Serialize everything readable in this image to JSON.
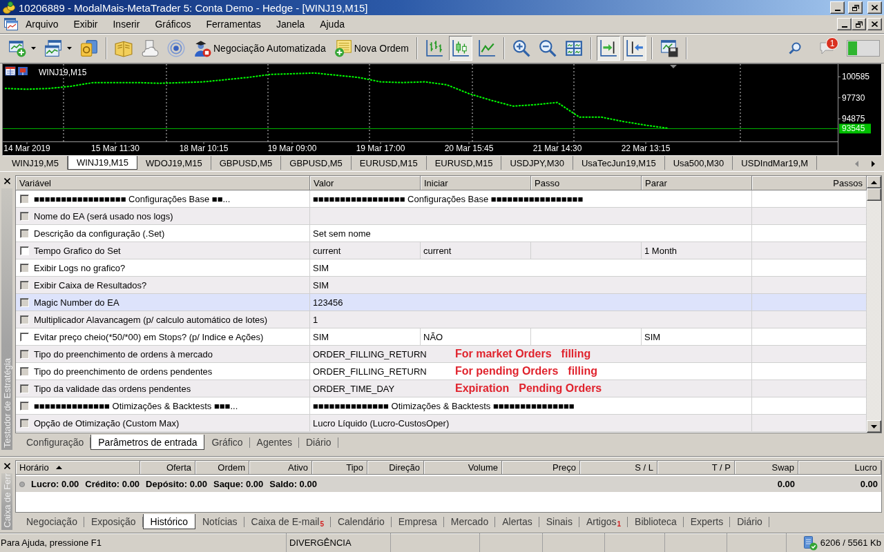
{
  "window": {
    "title": "10206889 - ModalMais-MetaTrader 5: Conta Demo - Hedge - [WINJ19,M15]"
  },
  "menu": [
    "Arquivo",
    "Exibir",
    "Inserir",
    "Gráficos",
    "Ferramentas",
    "Janela",
    "Ajuda"
  ],
  "toolbar": {
    "items": [
      {
        "kind": "button",
        "dropdown": true,
        "pressed": false
      },
      {
        "kind": "button",
        "dropdown": true,
        "pressed": false
      },
      {
        "kind": "button",
        "pressed": false
      },
      {
        "kind": "separator"
      },
      {
        "kind": "button",
        "pressed": false
      },
      {
        "kind": "button",
        "pressed": false
      },
      {
        "kind": "button",
        "pressed": false
      },
      {
        "kind": "button",
        "label": "Negociação Automatizada",
        "pressed": false
      },
      {
        "kind": "button",
        "label": "Nova Ordem",
        "pressed": false
      },
      {
        "kind": "separator"
      },
      {
        "kind": "button",
        "pressed": false
      },
      {
        "kind": "button",
        "pressed": true
      },
      {
        "kind": "button",
        "pressed": false
      },
      {
        "kind": "separator"
      },
      {
        "kind": "button",
        "pressed": false
      },
      {
        "kind": "button",
        "pressed": false
      },
      {
        "kind": "button",
        "pressed": false
      },
      {
        "kind": "separator"
      },
      {
        "kind": "button",
        "pressed": true
      },
      {
        "kind": "button",
        "pressed": true
      },
      {
        "kind": "separator"
      },
      {
        "kind": "button",
        "pressed": false
      },
      {
        "kind": "separator"
      }
    ],
    "notification_count": "1"
  },
  "chart": {
    "chart_data": {
      "type": "line",
      "title": "WINJ19,M15",
      "categories": [
        null,
        "14 Mar 2019",
        null,
        null,
        null,
        "15 Mar 11:30",
        null,
        null,
        null,
        "18 Mar 10:15",
        null,
        null,
        null,
        "19 Mar 09:00",
        null,
        null,
        null,
        "19 Mar 17:00",
        null,
        null,
        null,
        "20 Mar 15:45",
        null,
        null,
        null,
        "21 Mar 14:30",
        null,
        null,
        null,
        "22 Mar 13:15",
        null
      ],
      "series": [
        {
          "color": "#00ff00",
          "line_style": "dashed",
          "values": [
            99000,
            98900,
            99000,
            99300,
            99800,
            99800,
            99800,
            99700,
            99800,
            99900,
            100200,
            100500,
            100900,
            101000,
            101100,
            100800,
            100500,
            99900,
            99800,
            99900,
            99500,
            98300,
            97400,
            96600,
            96800,
            97100,
            95100,
            95100,
            94500,
            94000,
            93600
          ]
        }
      ],
      "ylim": [
        91800,
        102300
      ],
      "yticks": [
        100585,
        97730,
        94875
      ],
      "ref_lines": [
        {
          "axis": "y",
          "value": 93545,
          "label": "93545",
          "color": "#00c000"
        }
      ]
    }
  },
  "chart_tabs": [
    {
      "label": "WINJ19,M5",
      "selected": false
    },
    {
      "label": "WINJ19,M15",
      "selected": true
    },
    {
      "label": "WDOJ19,M15",
      "selected": false
    },
    {
      "label": "GBPUSD,M5",
      "selected": false
    },
    {
      "label": "GBPUSD,M5",
      "selected": false
    },
    {
      "label": "EURUSD,M15",
      "selected": false
    },
    {
      "label": "EURUSD,M15",
      "selected": false
    },
    {
      "label": "USDJPY,M30",
      "selected": false
    },
    {
      "label": "UsaTecJun19,M15",
      "selected": false
    },
    {
      "label": "Usa500,M30",
      "selected": false
    },
    {
      "label": "USDIndMar19,M",
      "selected": false
    }
  ],
  "strategy_tester": {
    "side_label": "Testador de Estratégia",
    "columns": [
      "Variável",
      "Valor",
      "Iniciar",
      "Passo",
      "Parar",
      "Passos"
    ],
    "rows": [
      {
        "kind": "plain",
        "variable": "■■■■■■■■■■■■■■■■■ Configurações Base ■■...",
        "value": "■■■■■■■■■■■■■■■■■ Configurações Base ■■■■■■■■■■■■■■■■■",
        "checked": false,
        "disabled": true,
        "selected": false
      },
      {
        "kind": "plain",
        "variable": "Nome do EA (será usado nos logs)",
        "checked": false,
        "disabled": true,
        "selected": false
      },
      {
        "kind": "plain",
        "variable": "Descrição da configuração (.Set)",
        "value": "Set sem nome",
        "checked": false,
        "disabled": true,
        "selected": false
      },
      {
        "kind": "range",
        "variable": "Tempo Grafico do Set",
        "value": "current",
        "start": "current",
        "stop": "1 Month",
        "checked": false,
        "disabled": false,
        "selected": false
      },
      {
        "kind": "plain",
        "variable": "Exibir Logs no grafico?",
        "value": "SIM",
        "checked": false,
        "disabled": true,
        "selected": false
      },
      {
        "kind": "plain",
        "variable": "Exibir Caixa de Resultados?",
        "value": "SIM",
        "checked": false,
        "disabled": true,
        "selected": false
      },
      {
        "kind": "plain",
        "variable": "Magic Number do EA",
        "value": "123456",
        "checked": false,
        "disabled": true,
        "selected": true
      },
      {
        "kind": "plain",
        "variable": "Multiplicador Alavancagem (p/ calculo automático de lotes)",
        "value": "1",
        "checked": false,
        "disabled": true,
        "selected": false
      },
      {
        "kind": "range",
        "variable": "Evitar preço cheio(*50/*00) em Stops? (p/ Indice e Ações)",
        "value": "SIM",
        "start": "NÃO",
        "stop": "SIM",
        "checked": false,
        "disabled": false,
        "selected": false
      },
      {
        "kind": "plain",
        "variable": "Tipo do preenchimento de ordens à mercado",
        "value": "ORDER_FILLING_RETURN",
        "notes": [
          "For market Orders",
          "filling"
        ],
        "checked": false,
        "disabled": true,
        "selected": false
      },
      {
        "kind": "plain",
        "variable": "Tipo do preenchimento de ordens pendentes",
        "value": "ORDER_FILLING_RETURN",
        "notes": [
          "For pending Orders",
          "filling"
        ],
        "checked": false,
        "disabled": true,
        "selected": false
      },
      {
        "kind": "plain",
        "variable": "Tipo da validade das ordens pendentes",
        "value": "ORDER_TIME_DAY",
        "notes": [
          "Expiration",
          "Pending Orders"
        ],
        "checked": false,
        "disabled": true,
        "selected": false
      },
      {
        "kind": "plain",
        "variable": "■■■■■■■■■■■■■■ Otimizações & Backtests ■■■...",
        "value": "■■■■■■■■■■■■■■ Otimizações & Backtests ■■■■■■■■■■■■■■■",
        "checked": false,
        "disabled": true,
        "selected": false
      },
      {
        "kind": "plain",
        "variable": "Opção de Otimização (Custom Max)",
        "value": "Lucro Líquido (Lucro-CustosOper)",
        "checked": false,
        "disabled": true,
        "selected": false
      }
    ],
    "tabs": [
      {
        "label": "Configuração",
        "selected": false
      },
      {
        "label": "Parâmetros de entrada",
        "selected": true
      },
      {
        "label": "Gráfico",
        "selected": false
      },
      {
        "label": "Agentes",
        "selected": false
      },
      {
        "label": "Diário",
        "selected": false
      }
    ]
  },
  "toolbox": {
    "side_label": "Caixa de Ferr",
    "columns": [
      {
        "label": "Horário",
        "sorted": true
      },
      {
        "label": "Oferta",
        "sorted": false
      },
      {
        "label": "Ordem",
        "sorted": false
      },
      {
        "label": "Ativo",
        "sorted": false
      },
      {
        "label": "Tipo",
        "sorted": false
      },
      {
        "label": "Direção",
        "sorted": false
      },
      {
        "label": "Volume",
        "sorted": false
      },
      {
        "label": "Preço",
        "sorted": false
      },
      {
        "label": "S / L",
        "sorted": false
      },
      {
        "label": "T / P",
        "sorted": false
      },
      {
        "label": "Swap",
        "sorted": false
      },
      {
        "label": "Lucro",
        "sorted": false
      }
    ],
    "summary": {
      "items": [
        "Lucro: 0.00",
        "Crédito: 0.00",
        "Depósito: 0.00",
        "Saque: 0.00",
        "Saldo: 0.00"
      ],
      "swap": "0.00",
      "profit": "0.00"
    },
    "tabs": [
      {
        "label": "Negociação",
        "selected": false
      },
      {
        "label": "Exposição",
        "selected": false
      },
      {
        "label": "Histórico",
        "selected": true
      },
      {
        "label": "Notícias",
        "selected": false
      },
      {
        "label": "Caixa de E-mail",
        "badge": "5",
        "selected": false
      },
      {
        "label": "Calendário",
        "selected": false
      },
      {
        "label": "Empresa",
        "selected": false
      },
      {
        "label": "Mercado",
        "selected": false
      },
      {
        "label": "Alertas",
        "selected": false
      },
      {
        "label": "Sinais",
        "selected": false
      },
      {
        "label": "Artigos",
        "badge": "1",
        "selected": false
      },
      {
        "label": "Biblioteca",
        "selected": false
      },
      {
        "label": "Experts",
        "selected": false
      },
      {
        "label": "Diário",
        "selected": false
      }
    ]
  },
  "status_bar": {
    "help": "Para Ajuda, pressione F1",
    "profile": "DIVERGÊNCIA",
    "traffic": "6206 / 5561 Kb"
  }
}
